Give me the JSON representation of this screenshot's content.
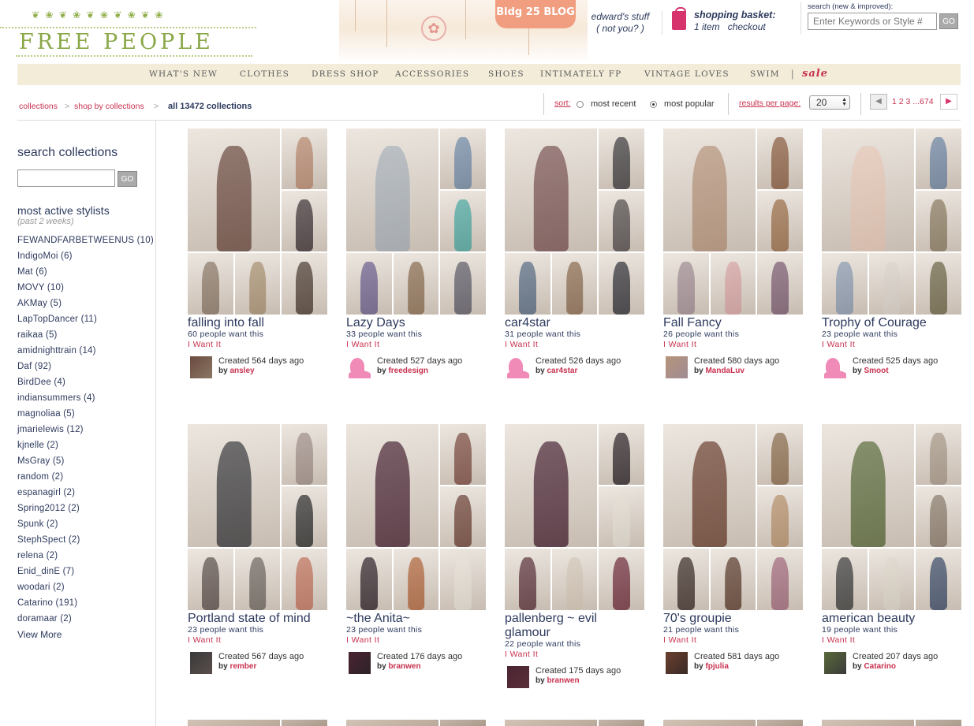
{
  "brand": {
    "name": "FREE PEOPLE",
    "blog_tag": "Bldg 25 BLOG"
  },
  "user": {
    "name": "edward's stuff",
    "not_you": "( not you? )"
  },
  "basket": {
    "title": "shopping basket:",
    "items": "1 item",
    "checkout": "checkout"
  },
  "search": {
    "label": "search (new & improved):",
    "placeholder": "Enter Keywords or Style #",
    "go": "GO"
  },
  "nav": {
    "items": [
      "WHAT'S NEW",
      "CLOTHES",
      "DRESS SHOP",
      "ACCESSORIES",
      "SHOES",
      "INTIMATELY FP",
      "VINTAGE LOVES",
      "SWIM"
    ],
    "sale": "sale",
    "separator": "|"
  },
  "breadcrumb": {
    "items": [
      "collections",
      "shop by collections"
    ],
    "separator": ">",
    "current": "all 13472 collections"
  },
  "sort": {
    "label": "sort:",
    "options": [
      "most recent",
      "most popular"
    ],
    "selected": "most popular"
  },
  "results": {
    "label": "results per page:",
    "value": "20"
  },
  "pagination": {
    "pages": "1 2 3 ...674"
  },
  "sidebar": {
    "search_title": "search collections",
    "go": "GO",
    "stylists_title": "most active stylists",
    "stylists_sub": "(past 2 weeks)",
    "stylists": [
      "FEWANDFARBETWEENUS (10)",
      "IndigoMoi (6)",
      "Mat (6)",
      "MOVY (10)",
      "AKMay (5)",
      "LapTopDancer (11)",
      "raikaa (5)",
      "amidnighttrain (14)",
      "Daf (92)",
      "BirdDee (4)",
      "indiansummers (4)",
      "magnoliaa (5)",
      "jmarielewis (12)",
      "kjnelle (2)",
      "MsGray (5)",
      "random (2)",
      "espanagirl (2)",
      "Spring2012 (2)",
      "Spunk (2)",
      "StephSpect (2)",
      "relena (2)",
      "Enid_dinE (7)",
      "woodari (2)",
      "Catarino (191)",
      "doramaar (2)"
    ],
    "view_more": "View More"
  },
  "collections": [
    {
      "title": "falling into fall",
      "count": "60 people want this",
      "want": "I Want It",
      "created": "Created 564 days ago",
      "by_label": "by",
      "by": "ansley",
      "avatar": "photo",
      "colors": [
        "#6b4a3f",
        "#b6876d",
        "#3b3033",
        "#8a7765",
        "#a8906f",
        "#4a3a30"
      ]
    },
    {
      "title": "Lazy Days",
      "count": "33 people want this",
      "want": "I Want It",
      "created": "Created 527 days ago",
      "by_label": "by",
      "by": "freedesign",
      "avatar": "pink",
      "colors": [
        "#a9b2ba",
        "#6f8aa8",
        "#4aa8a1",
        "#6a5d8c",
        "#8a6b4f",
        "#5d5a66"
      ]
    },
    {
      "title": "car4star",
      "count": "31 people want this",
      "want": "I Want It",
      "created": "Created 526 days ago",
      "by_label": "by",
      "by": "car4star",
      "avatar": "pink",
      "colors": [
        "#7a5454",
        "#3c3a3c",
        "#4f4848",
        "#566a82",
        "#8b6a4f",
        "#2e2e35"
      ]
    },
    {
      "title": "Fall Fancy",
      "count": "26 people want this",
      "want": "I Want It",
      "created": "Created 580 days ago",
      "by_label": "by",
      "by": "MandaLuv",
      "avatar": "photo",
      "colors": [
        "#b6947b",
        "#8a5b3f",
        "#9a6b45",
        "#a08c94",
        "#d7a3a3",
        "#7a5a6f"
      ]
    },
    {
      "title": "Trophy of Courage",
      "count": "23 people want this",
      "want": "I Want It",
      "created": "Created 525 days ago",
      "by_label": "by",
      "by": "Smoot",
      "avatar": "pink",
      "colors": [
        "#e8c9b8",
        "#6b83a3",
        "#8a7a60",
        "#8a9ab0",
        "#dcd4cc",
        "#6b6445"
      ]
    },
    {
      "title": "Portland state of mind",
      "count": "23 people want this",
      "want": "I Want It",
      "created": "Created 567 days ago",
      "by_label": "by",
      "by": "rember",
      "avatar": "photo",
      "colors": [
        "#3a3a3c",
        "#a08e88",
        "#2a2a2a",
        "#5a4e4a",
        "#6e6660",
        "#c0705a"
      ]
    },
    {
      "title": "~the Anita~",
      "count": "23 people want this",
      "want": "I Want It",
      "created": "Created 176 days ago",
      "by_label": "by",
      "by": "branwen",
      "avatar": "photo",
      "colors": [
        "#4a2433",
        "#7a4a3f",
        "#6b4035",
        "#2e2228",
        "#b0643a",
        "#e8e2d8"
      ]
    },
    {
      "title": "pallenberg ~ evil glamour",
      "count": "22 people want this",
      "want": "I Want It",
      "created": "Created 175 days ago",
      "by_label": "by",
      "by": "branwen",
      "avatar": "photo",
      "colors": [
        "#4a2433",
        "#2a2226",
        "#e6e0d4",
        "#5a3038",
        "#d4c8b8",
        "#6e2a3a"
      ]
    },
    {
      "title": "70's groupie",
      "count": "21 people want this",
      "want": "I Want It",
      "created": "Created 581 days ago",
      "by_label": "by",
      "by": "fpjulia",
      "avatar": "photo",
      "colors": [
        "#6b4030",
        "#8a6a4a",
        "#b6906a",
        "#3a2a26",
        "#5a3a2a",
        "#a0687a"
      ]
    },
    {
      "title": "american beauty",
      "count": "19 people want this",
      "want": "I Want It",
      "created": "Created 207 days ago",
      "by_label": "by",
      "by": "Catarino",
      "avatar": "photo",
      "colors": [
        "#5a6a3a",
        "#a89888",
        "#8a7a6a",
        "#3a3a3a",
        "#e0d8cc",
        "#3a4a66"
      ]
    }
  ]
}
